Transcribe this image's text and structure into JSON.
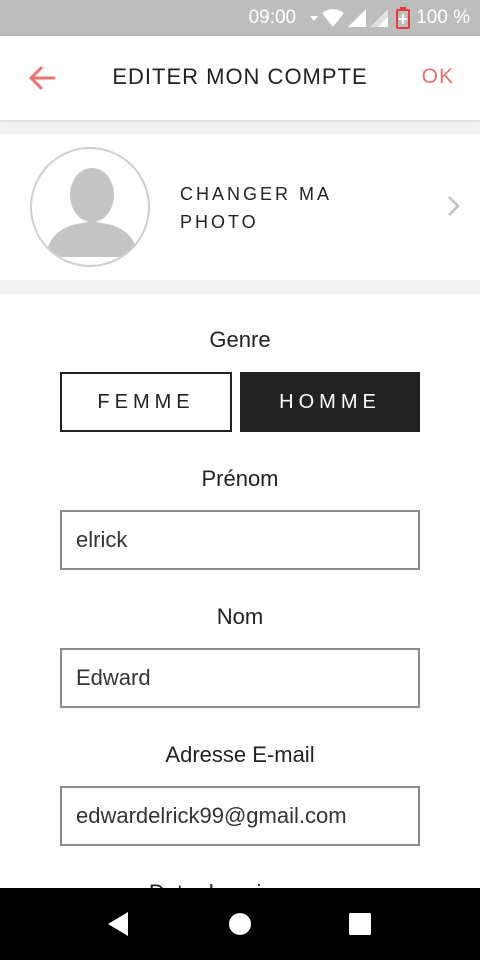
{
  "status_bar": {
    "time": "09:00",
    "battery": "100 %"
  },
  "header": {
    "title": "EDITER MON COMPTE",
    "ok_label": "OK",
    "back_icon": "arrow-left-icon"
  },
  "profile_photo": {
    "label": "CHANGER MA PHOTO"
  },
  "form": {
    "gender": {
      "label": "Genre",
      "options": [
        "FEMME",
        "HOMME"
      ],
      "selected": "HOMME"
    },
    "first_name": {
      "label": "Prénom",
      "value": "elrick"
    },
    "last_name": {
      "label": "Nom",
      "value": "Edward"
    },
    "email": {
      "label": "Adresse E-mail",
      "value": "edwardelrick99@gmail.com"
    },
    "next_label_partial": "Date de naissance"
  },
  "colors": {
    "accent": "#e9736d",
    "selected_bg": "#222222",
    "status_bar": "#bdbdbd"
  }
}
